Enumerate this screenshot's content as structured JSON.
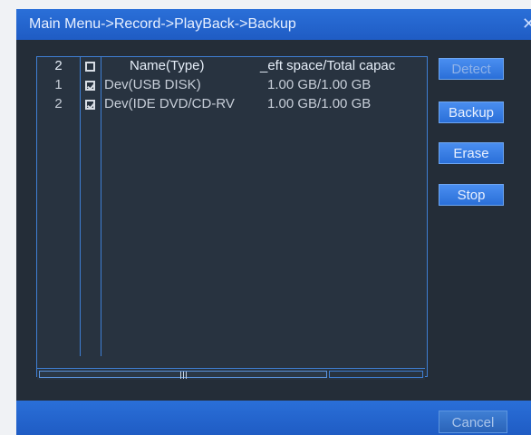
{
  "window": {
    "title": "Main Menu->Record->PlayBack->Backup",
    "close_glyph": "✕"
  },
  "table": {
    "header": {
      "count": "2",
      "name_col": "Name(Type)",
      "space_col": "_eft space/Total capac"
    },
    "rows": [
      {
        "num": "1",
        "checked": true,
        "name": "Dev(USB DISK)",
        "space": "1.00 GB/1.00 GB"
      },
      {
        "num": "2",
        "checked": true,
        "name": "Dev(IDE DVD/CD-RV",
        "space": "1.00 GB/1.00 GB"
      }
    ]
  },
  "buttons": {
    "detect": "Detect",
    "backup": "Backup",
    "erase": "Erase",
    "stop": "Stop",
    "cancel": "Cancel"
  },
  "icons": {
    "close": "close-icon",
    "scroll_grip": "scroll-grip-icon"
  }
}
